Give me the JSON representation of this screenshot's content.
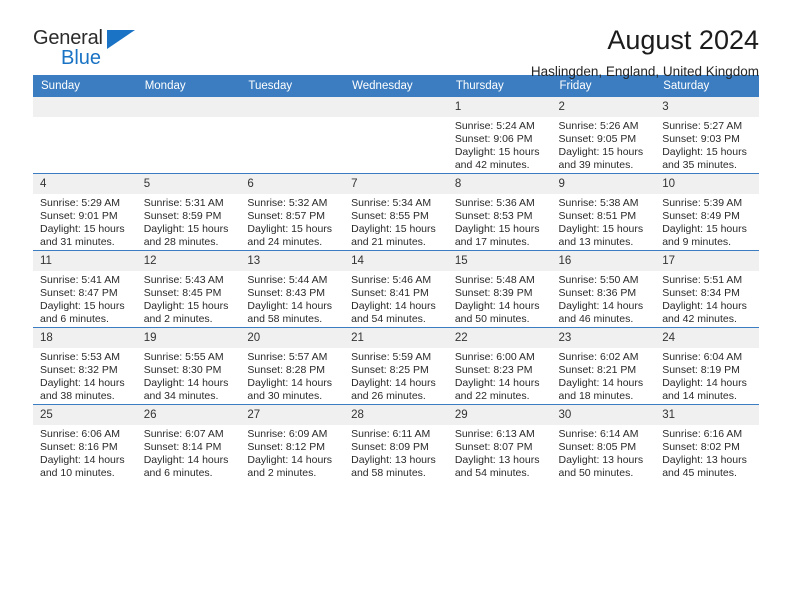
{
  "logo": {
    "word_top": "General",
    "word_bottom": "Blue",
    "triangle_color": "#1a73c4"
  },
  "header": {
    "title": "August 2024",
    "subtitle": "Haslingden, England, United Kingdom"
  },
  "theme": {
    "accent": "#3b7dc0",
    "daynum_bg": "#f0f0f0",
    "text": "#2a2a2a"
  },
  "calendar": {
    "weekday_headers": [
      "Sunday",
      "Monday",
      "Tuesday",
      "Wednesday",
      "Thursday",
      "Friday",
      "Saturday"
    ],
    "weeks": [
      [
        {
          "day": "",
          "empty": true,
          "sunrise": "",
          "sunset": "",
          "daylight_1": "",
          "daylight_2": ""
        },
        {
          "day": "",
          "empty": true,
          "sunrise": "",
          "sunset": "",
          "daylight_1": "",
          "daylight_2": ""
        },
        {
          "day": "",
          "empty": true,
          "sunrise": "",
          "sunset": "",
          "daylight_1": "",
          "daylight_2": ""
        },
        {
          "day": "",
          "empty": true,
          "sunrise": "",
          "sunset": "",
          "daylight_1": "",
          "daylight_2": ""
        },
        {
          "day": "1",
          "sunrise": "Sunrise: 5:24 AM",
          "sunset": "Sunset: 9:06 PM",
          "daylight_1": "Daylight: 15 hours",
          "daylight_2": "and 42 minutes."
        },
        {
          "day": "2",
          "sunrise": "Sunrise: 5:26 AM",
          "sunset": "Sunset: 9:05 PM",
          "daylight_1": "Daylight: 15 hours",
          "daylight_2": "and 39 minutes."
        },
        {
          "day": "3",
          "sunrise": "Sunrise: 5:27 AM",
          "sunset": "Sunset: 9:03 PM",
          "daylight_1": "Daylight: 15 hours",
          "daylight_2": "and 35 minutes."
        }
      ],
      [
        {
          "day": "4",
          "sunrise": "Sunrise: 5:29 AM",
          "sunset": "Sunset: 9:01 PM",
          "daylight_1": "Daylight: 15 hours",
          "daylight_2": "and 31 minutes."
        },
        {
          "day": "5",
          "sunrise": "Sunrise: 5:31 AM",
          "sunset": "Sunset: 8:59 PM",
          "daylight_1": "Daylight: 15 hours",
          "daylight_2": "and 28 minutes."
        },
        {
          "day": "6",
          "sunrise": "Sunrise: 5:32 AM",
          "sunset": "Sunset: 8:57 PM",
          "daylight_1": "Daylight: 15 hours",
          "daylight_2": "and 24 minutes."
        },
        {
          "day": "7",
          "sunrise": "Sunrise: 5:34 AM",
          "sunset": "Sunset: 8:55 PM",
          "daylight_1": "Daylight: 15 hours",
          "daylight_2": "and 21 minutes."
        },
        {
          "day": "8",
          "sunrise": "Sunrise: 5:36 AM",
          "sunset": "Sunset: 8:53 PM",
          "daylight_1": "Daylight: 15 hours",
          "daylight_2": "and 17 minutes."
        },
        {
          "day": "9",
          "sunrise": "Sunrise: 5:38 AM",
          "sunset": "Sunset: 8:51 PM",
          "daylight_1": "Daylight: 15 hours",
          "daylight_2": "and 13 minutes."
        },
        {
          "day": "10",
          "sunrise": "Sunrise: 5:39 AM",
          "sunset": "Sunset: 8:49 PM",
          "daylight_1": "Daylight: 15 hours",
          "daylight_2": "and 9 minutes."
        }
      ],
      [
        {
          "day": "11",
          "sunrise": "Sunrise: 5:41 AM",
          "sunset": "Sunset: 8:47 PM",
          "daylight_1": "Daylight: 15 hours",
          "daylight_2": "and 6 minutes."
        },
        {
          "day": "12",
          "sunrise": "Sunrise: 5:43 AM",
          "sunset": "Sunset: 8:45 PM",
          "daylight_1": "Daylight: 15 hours",
          "daylight_2": "and 2 minutes."
        },
        {
          "day": "13",
          "sunrise": "Sunrise: 5:44 AM",
          "sunset": "Sunset: 8:43 PM",
          "daylight_1": "Daylight: 14 hours",
          "daylight_2": "and 58 minutes."
        },
        {
          "day": "14",
          "sunrise": "Sunrise: 5:46 AM",
          "sunset": "Sunset: 8:41 PM",
          "daylight_1": "Daylight: 14 hours",
          "daylight_2": "and 54 minutes."
        },
        {
          "day": "15",
          "sunrise": "Sunrise: 5:48 AM",
          "sunset": "Sunset: 8:39 PM",
          "daylight_1": "Daylight: 14 hours",
          "daylight_2": "and 50 minutes."
        },
        {
          "day": "16",
          "sunrise": "Sunrise: 5:50 AM",
          "sunset": "Sunset: 8:36 PM",
          "daylight_1": "Daylight: 14 hours",
          "daylight_2": "and 46 minutes."
        },
        {
          "day": "17",
          "sunrise": "Sunrise: 5:51 AM",
          "sunset": "Sunset: 8:34 PM",
          "daylight_1": "Daylight: 14 hours",
          "daylight_2": "and 42 minutes."
        }
      ],
      [
        {
          "day": "18",
          "sunrise": "Sunrise: 5:53 AM",
          "sunset": "Sunset: 8:32 PM",
          "daylight_1": "Daylight: 14 hours",
          "daylight_2": "and 38 minutes."
        },
        {
          "day": "19",
          "sunrise": "Sunrise: 5:55 AM",
          "sunset": "Sunset: 8:30 PM",
          "daylight_1": "Daylight: 14 hours",
          "daylight_2": "and 34 minutes."
        },
        {
          "day": "20",
          "sunrise": "Sunrise: 5:57 AM",
          "sunset": "Sunset: 8:28 PM",
          "daylight_1": "Daylight: 14 hours",
          "daylight_2": "and 30 minutes."
        },
        {
          "day": "21",
          "sunrise": "Sunrise: 5:59 AM",
          "sunset": "Sunset: 8:25 PM",
          "daylight_1": "Daylight: 14 hours",
          "daylight_2": "and 26 minutes."
        },
        {
          "day": "22",
          "sunrise": "Sunrise: 6:00 AM",
          "sunset": "Sunset: 8:23 PM",
          "daylight_1": "Daylight: 14 hours",
          "daylight_2": "and 22 minutes."
        },
        {
          "day": "23",
          "sunrise": "Sunrise: 6:02 AM",
          "sunset": "Sunset: 8:21 PM",
          "daylight_1": "Daylight: 14 hours",
          "daylight_2": "and 18 minutes."
        },
        {
          "day": "24",
          "sunrise": "Sunrise: 6:04 AM",
          "sunset": "Sunset: 8:19 PM",
          "daylight_1": "Daylight: 14 hours",
          "daylight_2": "and 14 minutes."
        }
      ],
      [
        {
          "day": "25",
          "sunrise": "Sunrise: 6:06 AM",
          "sunset": "Sunset: 8:16 PM",
          "daylight_1": "Daylight: 14 hours",
          "daylight_2": "and 10 minutes."
        },
        {
          "day": "26",
          "sunrise": "Sunrise: 6:07 AM",
          "sunset": "Sunset: 8:14 PM",
          "daylight_1": "Daylight: 14 hours",
          "daylight_2": "and 6 minutes."
        },
        {
          "day": "27",
          "sunrise": "Sunrise: 6:09 AM",
          "sunset": "Sunset: 8:12 PM",
          "daylight_1": "Daylight: 14 hours",
          "daylight_2": "and 2 minutes."
        },
        {
          "day": "28",
          "sunrise": "Sunrise: 6:11 AM",
          "sunset": "Sunset: 8:09 PM",
          "daylight_1": "Daylight: 13 hours",
          "daylight_2": "and 58 minutes."
        },
        {
          "day": "29",
          "sunrise": "Sunrise: 6:13 AM",
          "sunset": "Sunset: 8:07 PM",
          "daylight_1": "Daylight: 13 hours",
          "daylight_2": "and 54 minutes."
        },
        {
          "day": "30",
          "sunrise": "Sunrise: 6:14 AM",
          "sunset": "Sunset: 8:05 PM",
          "daylight_1": "Daylight: 13 hours",
          "daylight_2": "and 50 minutes."
        },
        {
          "day": "31",
          "sunrise": "Sunrise: 6:16 AM",
          "sunset": "Sunset: 8:02 PM",
          "daylight_1": "Daylight: 13 hours",
          "daylight_2": "and 45 minutes."
        }
      ]
    ]
  }
}
